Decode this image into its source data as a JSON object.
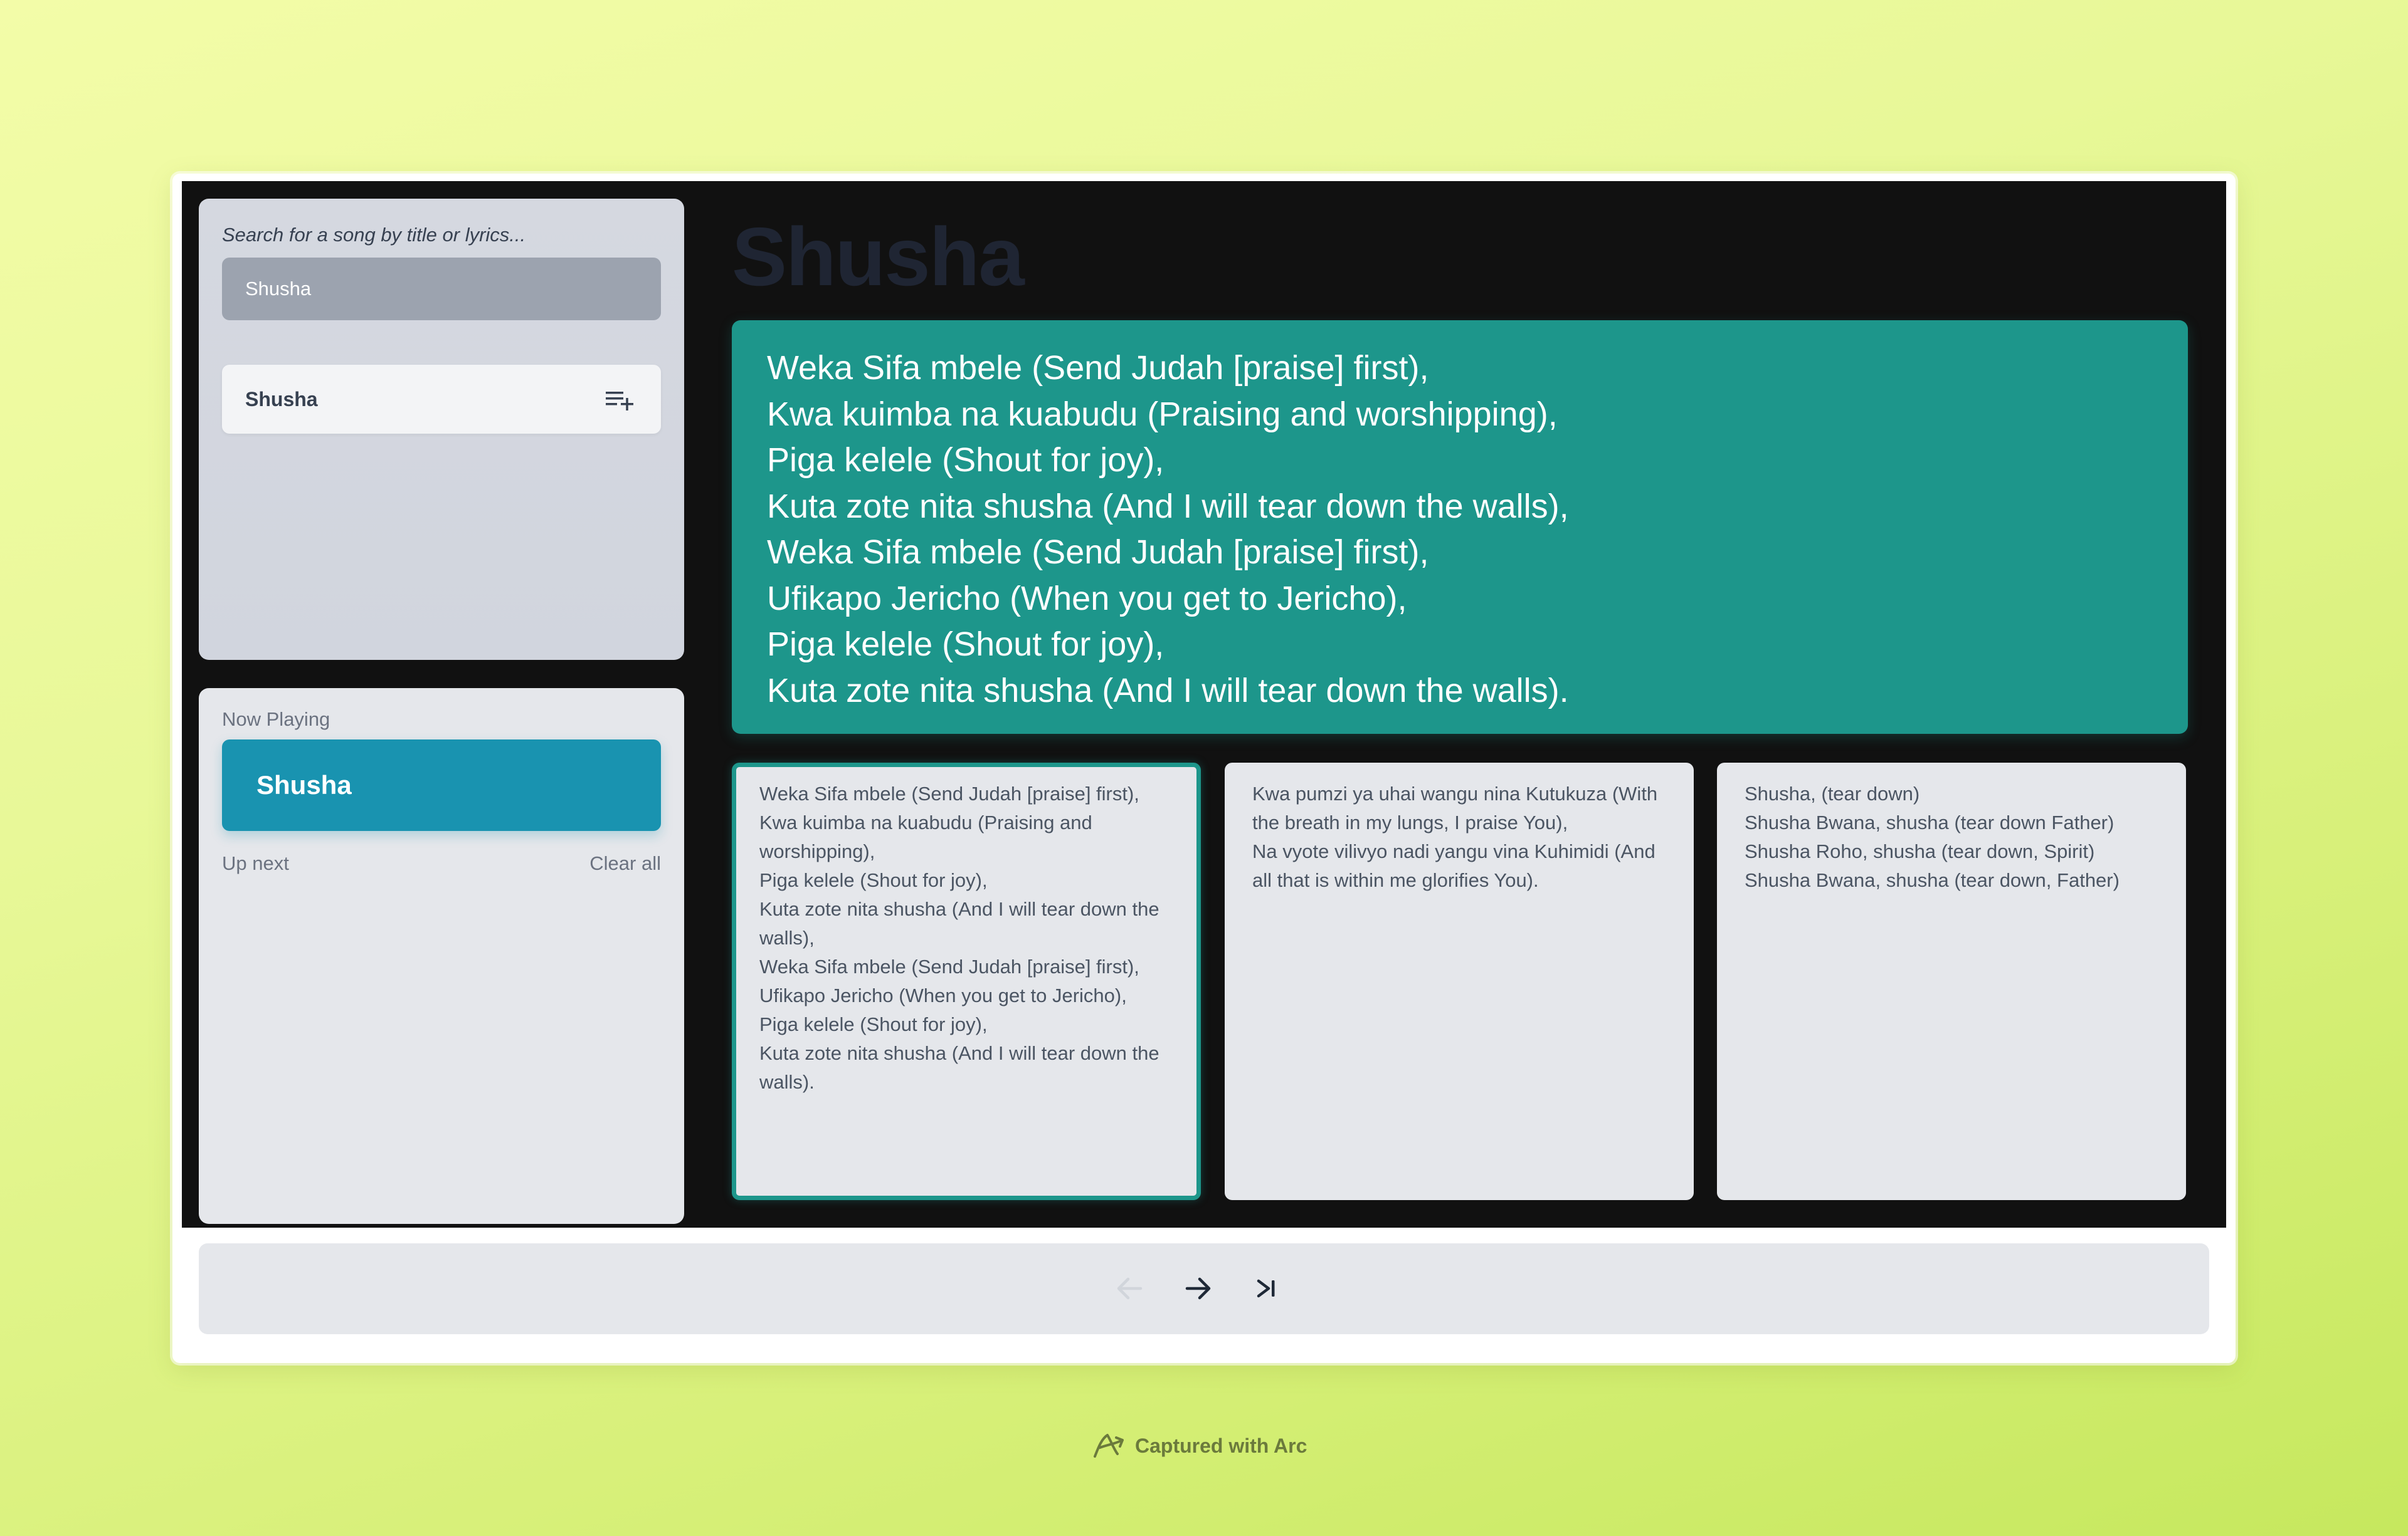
{
  "search": {
    "label": "Search for a song by title or lyrics...",
    "value": "Shusha",
    "results": [
      {
        "title": "Shusha",
        "action_icon": "playlist-add-icon"
      }
    ]
  },
  "now_playing": {
    "label": "Now Playing",
    "title": "Shusha",
    "up_next_label": "Up next",
    "clear_all_label": "Clear all"
  },
  "song": {
    "title": "Shusha",
    "current_verse": [
      "Weka Sifa mbele (Send Judah [praise] first),",
      "Kwa kuimba na kuabudu (Praising and worshipping),",
      "Piga kelele (Shout for joy),",
      "Kuta zote nita shusha (And I will tear down the walls),",
      "Weka Sifa mbele (Send Judah [praise] first),",
      "Ufikapo Jericho (When you get to Jericho),",
      "Piga kelele (Shout for joy),",
      "Kuta zote nita shusha (And I will tear down the walls)."
    ],
    "verses": [
      {
        "active": true,
        "lines": [
          "Weka Sifa mbele (Send Judah [praise] first),",
          "Kwa kuimba na kuabudu (Praising and worshipping),",
          "Piga kelele (Shout for joy),",
          "Kuta zote nita shusha (And I will tear down the walls),",
          "Weka Sifa mbele (Send Judah [praise] first),",
          "Ufikapo Jericho (When you get to Jericho),",
          "Piga kelele (Shout for joy),",
          "Kuta zote nita shusha (And I will tear down the walls)."
        ]
      },
      {
        "active": false,
        "lines": [
          "Kwa pumzi ya uhai wangu nina Kutukuza (With the breath in my lungs, I praise You),",
          "Na vyote vilivyo nadi yangu vina Kuhimidi (And all that is within me glorifies You)."
        ]
      },
      {
        "active": false,
        "lines": [
          "Shusha, (tear down)",
          "Shusha Bwana, shusha (tear down Father)",
          "Shusha Roho, shusha (tear down, Spirit)",
          "Shusha Bwana, shusha (tear down, Father)"
        ]
      }
    ]
  },
  "controls": {
    "prev_icon": "arrow-left-icon",
    "next_icon": "arrow-right-icon",
    "skip_icon": "skip-end-icon",
    "prev_disabled": true
  },
  "footer": {
    "badge_text": "Captured with Arc"
  },
  "colors": {
    "accent_teal": "#1d968b",
    "now_playing_blue": "#1993b0",
    "app_background": "#111111",
    "panel": "#e5e7eb"
  }
}
